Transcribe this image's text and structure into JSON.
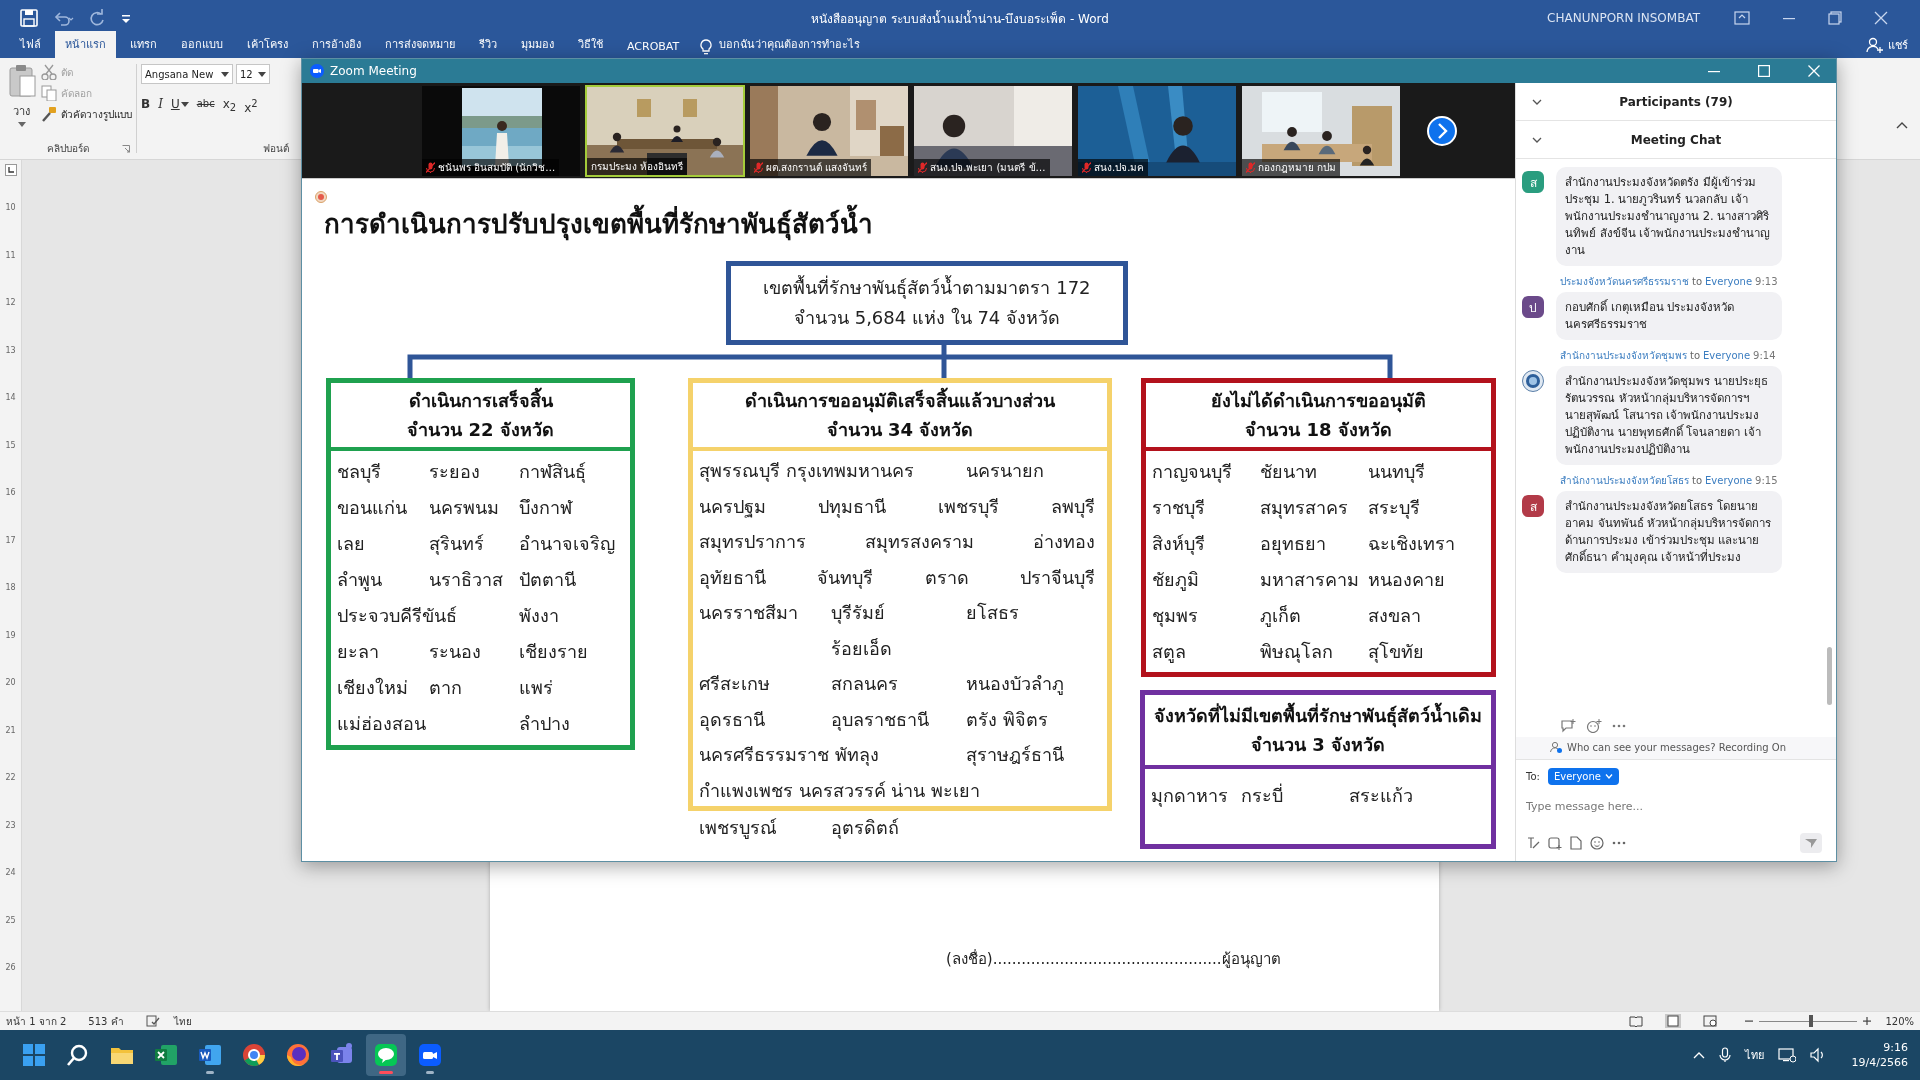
{
  "word": {
    "title": "หนังสืออนุญาต ระบบส่งน้ำแม่น้ำน่าน-บึงบอระเพ็ด - Word",
    "user": "CHANUNPORN INSOMBAT",
    "tabs": [
      {
        "label": "ไฟล์",
        "selected": false
      },
      {
        "label": "หน้าแรก",
        "selected": true
      },
      {
        "label": "แทรก",
        "selected": false
      },
      {
        "label": "ออกแบบ",
        "selected": false
      },
      {
        "label": "เค้าโครง",
        "selected": false
      },
      {
        "label": "การอ้างอิง",
        "selected": false
      },
      {
        "label": "การส่งจดหมาย",
        "selected": false
      },
      {
        "label": "รีวิว",
        "selected": false
      },
      {
        "label": "มุมมอง",
        "selected": false
      },
      {
        "label": "วิธีใช้",
        "selected": false
      },
      {
        "label": "ACROBAT",
        "selected": false
      }
    ],
    "tell_me": "บอกฉันว่าคุณต้องการทำอะไร",
    "share": "แชร์",
    "clipboard": {
      "paste": "วาง",
      "items": [
        {
          "kind": "cut",
          "label": "ตัด",
          "disabled": true
        },
        {
          "kind": "copy",
          "label": "คัดลอก",
          "disabled": true
        },
        {
          "kind": "format",
          "label": "ตัวคัดวางรูปแบบ",
          "disabled": false
        }
      ],
      "group": "คลิปบอร์ด"
    },
    "font": {
      "name": "Angsana New",
      "size": "12",
      "buttons": [
        "B",
        "I",
        "U",
        "abc",
        "x$_{2}$",
        "x$^{2}$"
      ],
      "group": "ฟอนต์"
    },
    "ruler_marks": [
      "10",
      "11",
      "12",
      "13",
      "14",
      "15",
      "16",
      "17",
      "18",
      "19",
      "20",
      "21",
      "22",
      "23",
      "24",
      "25",
      "26"
    ],
    "document": {
      "signature": "(ลงชื่อ)................................................ผู้อนุญาต"
    },
    "status_bar": {
      "page": "หน้า 1 จาก 2",
      "words": "513 คำ",
      "language": "ไทย",
      "zoom_slider": {
        "level": 0.53
      },
      "zoom": "120%"
    }
  },
  "zoom_meeting": {
    "title": "Zoom Meeting",
    "videos": [
      {
        "name": "ชนันพร อินสมบัติ (นักวิช…",
        "muted": true,
        "selected": false
      },
      {
        "name": "กรมประมง ห้องอินทรี",
        "muted": false,
        "selected": true
      },
      {
        "name": "ผต.สงกรานต์ แสงจันทร์",
        "muted": true,
        "selected": false
      },
      {
        "name": "สนง.ปจ.พะเยา (มนตรี  ข้…",
        "muted": true,
        "selected": false
      },
      {
        "name": "สนง.ปจ.มค",
        "muted": true,
        "selected": false
      },
      {
        "name": "กองกฎหมาย กปม",
        "muted": true,
        "selected": false
      }
    ],
    "slide": {
      "title": "การดำเนินการปรับปรุงเขตพื้นที่รักษาพันธุ์สัตว์น้ำ",
      "root": [
        "เขตพื้นที่รักษาพันธุ์สัตว์น้ำตามมาตรา 172",
        "จำนวน 5,684 แห่ง ใน 74 จังหวัด"
      ],
      "groups": [
        {
          "color": "#1fa14f",
          "heading": [
            "ดำเนินการเสร็จสิ้น",
            "จำนวน 22 จังหวัด"
          ],
          "rows": [
            {
              "kind": "grid",
              "cells": [
                "ชลบุรี",
                "ระยอง",
                "กาฬสินธุ์"
              ]
            },
            {
              "kind": "grid",
              "cells": [
                "ขอนแก่น",
                "นครพนม",
                "บึงกาฬ"
              ]
            },
            {
              "kind": "grid",
              "cells": [
                "เลย",
                "สุรินทร์",
                "อำนาจเจริญ"
              ]
            },
            {
              "kind": "grid",
              "cells": [
                "ลำพูน",
                "นราธิวาส",
                "ปัตตานี"
              ]
            },
            {
              "kind": "grid",
              "cells": [
                "ประจวบคีรีขันธ์",
                "พังงา"
              ]
            },
            {
              "kind": "grid",
              "cells": [
                "ยะลา",
                "ระนอง",
                "เชียงราย"
              ]
            },
            {
              "kind": "grid",
              "cells": [
                "เชียงใหม่",
                "ตาก",
                "แพร่"
              ]
            },
            {
              "kind": "grid",
              "cells": [
                "แม่ฮ่องสอน",
                "ลำปาง"
              ]
            }
          ]
        },
        {
          "color": "#f5d26b",
          "heading": [
            "ดำเนินการขออนุมัติเสร็จสิ้นแล้วบางส่วน",
            "จำนวน 34 จังหวัด"
          ],
          "rows": [
            {
              "kind": "grid",
              "cells": [
                "สุพรรณบุรี กรุงเทพมหานคร",
                "นครนายก"
              ]
            },
            {
              "kind": "spread",
              "cells": [
                "นครปฐม",
                "ปทุมธานี",
                "เพชรบุรี",
                "ลพบุรี"
              ]
            },
            {
              "kind": "spread",
              "cells": [
                "สมุทรปราการ",
                "สมุทรสงคราม",
                "อ่างทอง"
              ]
            },
            {
              "kind": "spread",
              "cells": [
                "อุทัยธานี",
                "จันทบุรี",
                "ตราด",
                "ปราจีนบุรี"
              ]
            },
            {
              "kind": "grid",
              "cells": [
                "นครราชสีมา",
                "บุรีรัมย์",
                "ยโสธร"
              ]
            },
            {
              "kind": "indent",
              "cells": [
                "ร้อยเอ็ด"
              ]
            },
            {
              "kind": "grid",
              "cells": [
                "ศรีสะเกษ",
                "สกลนคร",
                "หนองบัวลำภู"
              ]
            },
            {
              "kind": "grid",
              "cells": [
                "อุดรธานี",
                "อุบลราชธานี",
                "ตรัง พิจิตร"
              ]
            },
            {
              "kind": "grid",
              "cells": [
                "นครศรีธรรมราช พัทลุง",
                "สุราษฎร์ธานี"
              ]
            },
            {
              "kind": "grid",
              "cells": [
                "กำแพงเพชร นครสวรรค์ น่าน พะเยา"
              ]
            }
          ],
          "overflow": [
            "เพชรบูรณ์",
            "อุตรดิตถ์"
          ]
        },
        {
          "color": "#b3121c",
          "heading": [
            "ยังไม่ได้ดำเนินการขออนุมัติ",
            "จำนวน 18 จังหวัด"
          ],
          "rows": [
            {
              "kind": "grid",
              "cells": [
                "กาญจนบุรี",
                "ชัยนาท",
                "นนทบุรี"
              ]
            },
            {
              "kind": "grid",
              "cells": [
                "ราชบุรี",
                "สมุทรสาคร",
                "สระบุรี"
              ]
            },
            {
              "kind": "grid",
              "cells": [
                "สิงห์บุรี",
                "อยุทธยา",
                "ฉะเชิงเทรา"
              ]
            },
            {
              "kind": "grid",
              "cells": [
                "ชัยภูมิ",
                "มหาสารคาม",
                "หนองคาย"
              ]
            },
            {
              "kind": "grid",
              "cells": [
                "ชุมพร",
                "ภูเก็ต",
                "สงขลา"
              ]
            },
            {
              "kind": "grid",
              "cells": [
                "สตูล",
                "พิษณุโลก",
                "สุโขทัย"
              ]
            }
          ]
        },
        {
          "color": "#7030a0",
          "heading": [
            "จังหวัดที่ไม่มีเขตพื้นที่รักษาพันธุ์สัตว์น้ำเดิม",
            "จำนวน 3 จังหวัด"
          ],
          "rows": [
            {
              "kind": "grid",
              "cells": [
                "มุกดาหาร",
                "กระบี่",
                "สระแก้ว"
              ]
            }
          ]
        }
      ]
    },
    "panel": {
      "participants": "Participants (79)",
      "chat_title": "Meeting Chat",
      "messages": [
        {
          "kind": "letter",
          "avatar": "ส",
          "color": "#2a9d7f",
          "text": "สำนักงานประมงจังหวัดตรัง มีผู้เข้าร่วมประชุม  1. นายภูวรินทร์ นวลกลับ เจ้าพนักงานประมงชำนาญงาน 2. นางสาวศิรินทิพย์ สังข์จีน เจ้าพนักงานประมงชำนาญงาน"
        },
        {
          "kind": "letter",
          "avatar": "ป",
          "color": "#6b4a8a",
          "sender": "ประมงจังหวัดนครศรีธรรมราช",
          "to": "to",
          "recipient": "Everyone",
          "time": "9:13",
          "text": "กอบศักดิ์ เกตุเหมือน ประมงจังหวัดนครศรีธรรมราช"
        },
        {
          "kind": "logo",
          "sender": "สำนักงานประมงจังหวัดชุมพร",
          "to": "to",
          "recipient": "Everyone",
          "time": "9:14",
          "text": "สำนักงานประมงจังหวัดชุมพร นายประยุธ รัตนวรรณ หัวหน้ากลุ่มบริหารจัดการฯ นายสุพัฒน์ โสนารถ เจ้าพนักงานประมงปฏิบัติงาน นายพุทธศักดิ์ โจนลายดา เจ้าพนักงานประมงปฏิบัติงาน"
        },
        {
          "kind": "letter",
          "avatar": "ส",
          "color": "#b23a48",
          "sender": "สำนักงานประมงจังหวัดยโสธร",
          "to": "to",
          "recipient": "Everyone",
          "time": "9:15",
          "text": "สำนักงานประมงจังหวัดยโสธร โดยนายอาคม  จันทพันธ์  หัวหน้ากลุ่มบริหารจัดการด้านการประมง เข้าร่วมประชุม และนายศักดิ์ธนา  คำมุงคุณ เจ้าหน้าที่ประมง"
        }
      ],
      "privacy_note": "Who can see your messages? Recording On",
      "to_label": "To:",
      "recipient": "Everyone",
      "placeholder": "Type message here..."
    }
  },
  "taskbar": {
    "apps": [
      {
        "kind": "start",
        "running": false,
        "selected": false
      },
      {
        "kind": "search",
        "running": false,
        "selected": false
      },
      {
        "kind": "folder",
        "running": false,
        "selected": false
      },
      {
        "kind": "sheet",
        "running": false,
        "selected": false
      },
      {
        "kind": "doc",
        "running": true,
        "selected": false
      },
      {
        "kind": "browser",
        "running": false,
        "selected": false
      },
      {
        "kind": "fox",
        "running": false,
        "selected": false
      },
      {
        "kind": "team",
        "running": false,
        "selected": false
      },
      {
        "kind": "chat",
        "running": true,
        "selected": true
      },
      {
        "kind": "video",
        "running": true,
        "selected": false
      }
    ],
    "language": "ไทย",
    "time": "9:16",
    "date": "19/4/2566"
  }
}
